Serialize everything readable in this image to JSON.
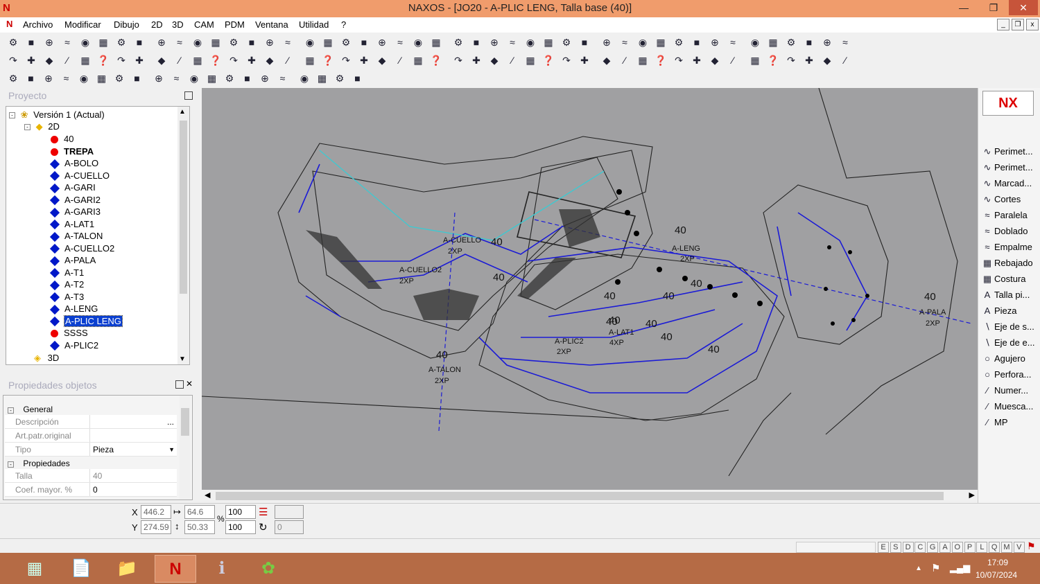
{
  "window": {
    "title": "NAXOS - [JO20 - A-PLIC LENG, Talla base (40)]"
  },
  "menu": [
    "Archivo",
    "Modificar",
    "Dibujo",
    "2D",
    "3D",
    "CAM",
    "PDM",
    "Ventana",
    "Utilidad",
    "?"
  ],
  "project": {
    "title": "Proyecto",
    "root": "Versión 1 (Actual)",
    "node2d": "2D",
    "items": [
      {
        "label": "40",
        "type": "dot"
      },
      {
        "label": "TREPA",
        "type": "dot"
      },
      {
        "label": "A-BOLO",
        "type": "dia"
      },
      {
        "label": "A-CUELLO",
        "type": "dia"
      },
      {
        "label": "A-GARI",
        "type": "dia"
      },
      {
        "label": "A-GARI2",
        "type": "dia"
      },
      {
        "label": "A-GARI3",
        "type": "dia"
      },
      {
        "label": "A-LAT1",
        "type": "dia"
      },
      {
        "label": "A-TALON",
        "type": "dia"
      },
      {
        "label": "A-CUELLO2",
        "type": "dia"
      },
      {
        "label": "A-PALA",
        "type": "dia"
      },
      {
        "label": "A-T1",
        "type": "dia"
      },
      {
        "label": "A-T2",
        "type": "dia"
      },
      {
        "label": "A-T3",
        "type": "dia"
      },
      {
        "label": "A-LENG",
        "type": "dia"
      },
      {
        "label": "A-PLIC LENG",
        "type": "dia"
      },
      {
        "label": "SSSS",
        "type": "dot"
      },
      {
        "label": "A-PLIC2",
        "type": "dia"
      }
    ],
    "node3d": "3D"
  },
  "properties": {
    "title": "Propiedades objetos",
    "general": "General",
    "props_group": "Propiedades",
    "rows1": [
      {
        "k": "Descripción",
        "v": "",
        "btn": "..."
      },
      {
        "k": "Art.patr.original",
        "v": ""
      },
      {
        "k": "Tipo",
        "v": "Pieza"
      }
    ],
    "rows2": [
      {
        "k": "Talla",
        "v": "40"
      },
      {
        "k": "Coef. mayor. %",
        "v": "0"
      }
    ]
  },
  "right_tools": [
    "Perimet...",
    "Perimet...",
    "Marcad...",
    "Cortes",
    "Paralela",
    "Doblado",
    "Empalme",
    "Rebajado",
    "Costura",
    "Talla pi...",
    "Pieza",
    "Eje de s...",
    "Eje de e...",
    "Agujero",
    "Perfora...",
    "Numer...",
    "Muesca...",
    "MP"
  ],
  "coords": {
    "x": "446.2",
    "y": "274.59",
    "w": "64.6",
    "h": "50.33",
    "sx": "100",
    "sy": "100",
    "rot": "0",
    "x_label": "X",
    "y_label": "Y",
    "pct": "%"
  },
  "status": [
    "E",
    "S",
    "D",
    "C",
    "G",
    "A",
    "O",
    "P",
    "L",
    "Q",
    "M",
    "V"
  ],
  "canvas": {
    "labels": [
      "A-CUELLO",
      "2XP",
      "A-CUELLO2",
      "2XP",
      "40",
      "40",
      "40",
      "A-TALON",
      "2XP",
      "40",
      "A-LENG",
      "2XP",
      "40",
      "40",
      "40",
      "A-LAT1",
      "4XP",
      "40",
      "40",
      "A-PLIC2",
      "2XP",
      "40",
      "40",
      "40",
      "A-PALA",
      "2XP",
      "40"
    ]
  },
  "taskbar": {
    "time": "17:09",
    "date": "10/07/2024"
  },
  "colors": {
    "title": "#f09c6c",
    "canvas": "#a0a0a2",
    "taskbar": "#b56b45",
    "blue": "#1a1ad6"
  }
}
